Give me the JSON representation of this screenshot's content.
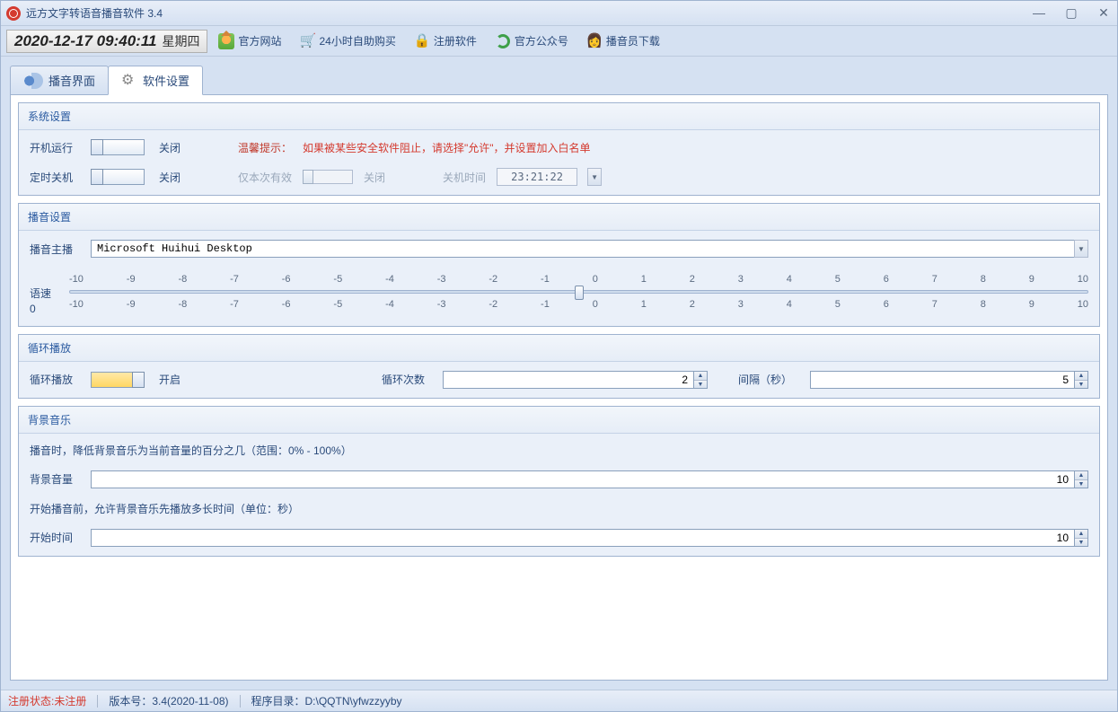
{
  "titlebar": {
    "title": "远方文字转语音播音软件 3.4"
  },
  "toolbar": {
    "datetime": "2020-12-17 09:40:11",
    "dayofweek": "星期四",
    "links": {
      "site": "官方网站",
      "buy": "24小时自助购买",
      "register": "注册软件",
      "wechat": "官方公众号",
      "download": "播音员下载"
    }
  },
  "tabs": {
    "broadcast": "播音界面",
    "settings": "软件设置"
  },
  "groups": {
    "system": {
      "title": "系统设置",
      "autorun": "开机运行",
      "autorun_state": "关闭",
      "shutdown": "定时关机",
      "shutdown_state": "关闭",
      "hint_prefix": "温馨提示：",
      "hint_text": "如果被某些安全软件阻止，请选择\"允许\"，并设置加入白名单",
      "once_only": "仅本次有效",
      "once_state": "关闭",
      "shutdown_time_label": "关机时间",
      "shutdown_time": "23:21:22"
    },
    "broadcast": {
      "title": "播音设置",
      "voice_label": "播音主播",
      "voice_value": "Microsoft Huihui Desktop",
      "speed_label": "语速",
      "speed_value": "0",
      "ticks": [
        "-10",
        "-9",
        "-8",
        "-7",
        "-6",
        "-5",
        "-4",
        "-3",
        "-2",
        "-1",
        "0",
        "1",
        "2",
        "3",
        "4",
        "5",
        "6",
        "7",
        "8",
        "9",
        "10"
      ]
    },
    "loop": {
      "title": "循环播放",
      "loop_label": "循环播放",
      "loop_state": "开启",
      "count_label": "循环次数",
      "count_value": "2",
      "interval_label": "间隔（秒）",
      "interval_value": "5"
    },
    "bgm": {
      "title": "背景音乐",
      "vol_desc": "播音时，降低背景音乐为当前音量的百分之几（范围：0% - 100%）",
      "vol_label": "背景音量",
      "vol_value": "10",
      "delay_desc": "开始播音前，允许背景音乐先播放多长时间（单位：秒）",
      "delay_label": "开始时间",
      "delay_value": "10"
    }
  },
  "footer": {
    "reg_status": "注册状态:未注册",
    "version": "版本号：3.4(2020-11-08)",
    "dir": "程序目录：D:\\QQTN\\yfwzzyyby"
  }
}
